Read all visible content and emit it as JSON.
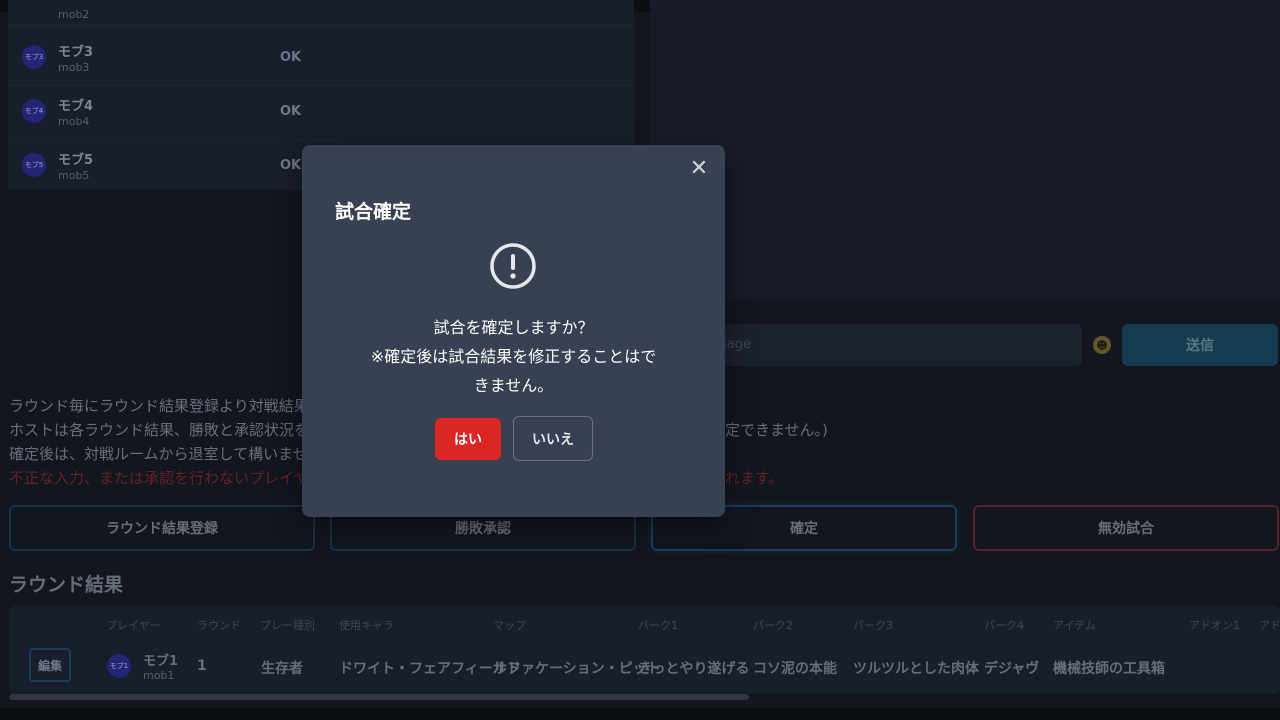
{
  "players": [
    {
      "name": "",
      "id": "mob2",
      "status": "",
      "avatar": ""
    },
    {
      "name": "モブ3",
      "id": "mob3",
      "status": "OK",
      "avatar": "モブ3"
    },
    {
      "name": "モブ4",
      "id": "mob4",
      "status": "OK",
      "avatar": "モブ4"
    },
    {
      "name": "モブ5",
      "id": "mob5",
      "status": "OK",
      "avatar": "モブ5"
    }
  ],
  "chat": {
    "placeholder_visible": "sage",
    "send_label": "送信",
    "emoji": "☻"
  },
  "instructions": {
    "line1": "ラウンド毎にラウンド結果登録より対戦結果を入",
    "line2_left": "ホストは各ラウンド結果、勝敗と承認状況を確",
    "line2_right": "定できません。)",
    "line3": "確定後は、対戦ルームから退室して構いませ",
    "line4_left": "不正な入力、または承認を行わないプレイヤー",
    "line4_right": "れます。"
  },
  "actions": {
    "register": "ラウンド結果登録",
    "approve": "勝敗承認",
    "confirm": "確定",
    "void": "無効試合"
  },
  "round_results": {
    "title": "ラウンド結果",
    "headers": [
      "プレイヤー",
      "ラウンド",
      "プレー種別",
      "使用キャラ",
      "マップ",
      "パーク1",
      "パーク2",
      "パーク3",
      "パーク4",
      "アイテム",
      "アドオン1",
      "アド"
    ],
    "row": {
      "edit": "編集",
      "avatar": "モブ1",
      "player": "モブ1",
      "player_id": "mob1",
      "round": "1",
      "type": "生存者",
      "character": "ドワイト・フェアフィールド",
      "map": "サファケーション・ピット",
      "perk1": "きっとやり遂げる",
      "perk2": "コソ泥の本能",
      "perk3": "ツルツルとした肉体",
      "perk4": "デジャヴ",
      "item": "機械技師の工具箱"
    }
  },
  "modal": {
    "title": "試合確定",
    "line1": "試合を確定しますか？",
    "line2": "※確定後は試合結果を修正することはで",
    "line3": "きません。",
    "yes": "はい",
    "no": "いいえ",
    "close": "✕"
  }
}
